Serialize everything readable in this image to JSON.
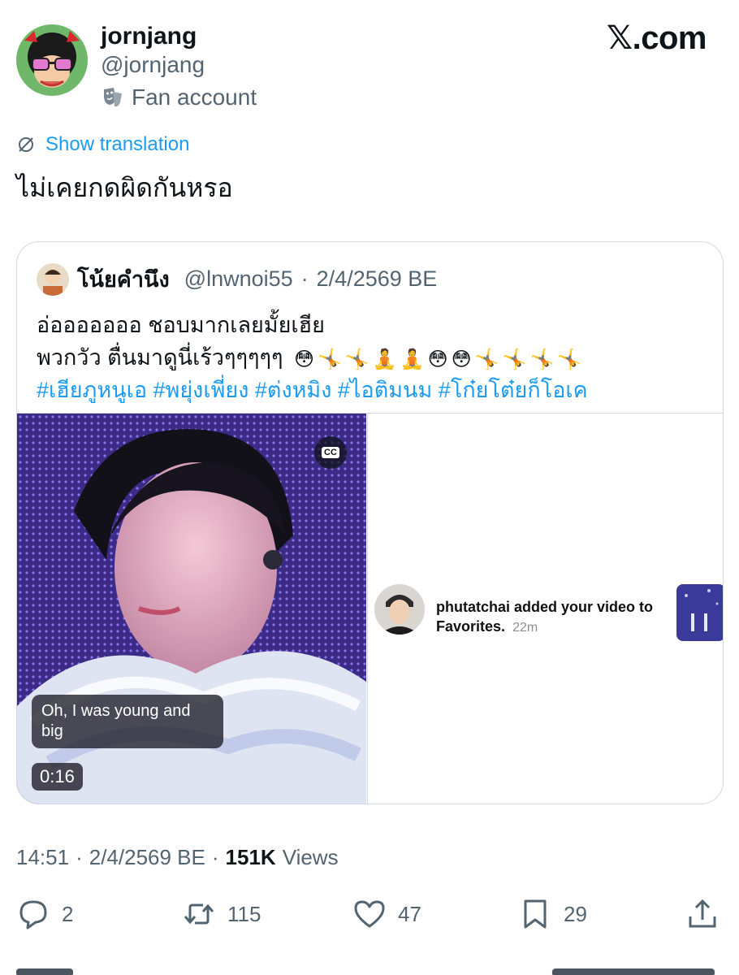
{
  "author": {
    "name": "jornjang",
    "handle": "@jornjang",
    "label": "Fan account"
  },
  "brand": "𝕏.com",
  "translation_link": "Show translation",
  "tweet_text": "ไม่เคยกดผิดกันหรอ",
  "quote": {
    "name": "โน้ยคำนึง",
    "handle": "@lnwnoi55",
    "date": "2/4/2569 BE",
    "line1": "อ่อออออออ ชอบมากเลยมั้ยเฮีย",
    "line2": "พวกวัว ตื่นมาดูนี่เร้วๆๆๆๆๆ",
    "emojis": [
      "😳",
      "🤸",
      "🤸",
      "🧘",
      "🧘",
      "😳",
      "😳",
      "🤸",
      "🤸",
      "🤸",
      "🤸"
    ],
    "hashtags": "#เฮียภูหนูเอ #พยุ่งเพี่ยง #ต่งหมิง #ไอติมนม #โก๋ยโต๋ยก็โอเค",
    "video": {
      "cc_label": "CC",
      "caption": "Oh, I was young and big",
      "duration": "0:16"
    },
    "notification": {
      "text": "phutatchai added your video to Favorites.",
      "time": "22m"
    }
  },
  "meta": {
    "time": "14:51",
    "date": "2/4/2569 BE",
    "views_count": "151K",
    "views_label": "Views"
  },
  "actions": {
    "replies": "2",
    "reposts": "115",
    "likes": "47",
    "bookmarks": "29"
  },
  "colors": {
    "link": "#1d9bf0",
    "muted": "#536471",
    "text": "#0f1419",
    "border": "#cfd9de"
  }
}
